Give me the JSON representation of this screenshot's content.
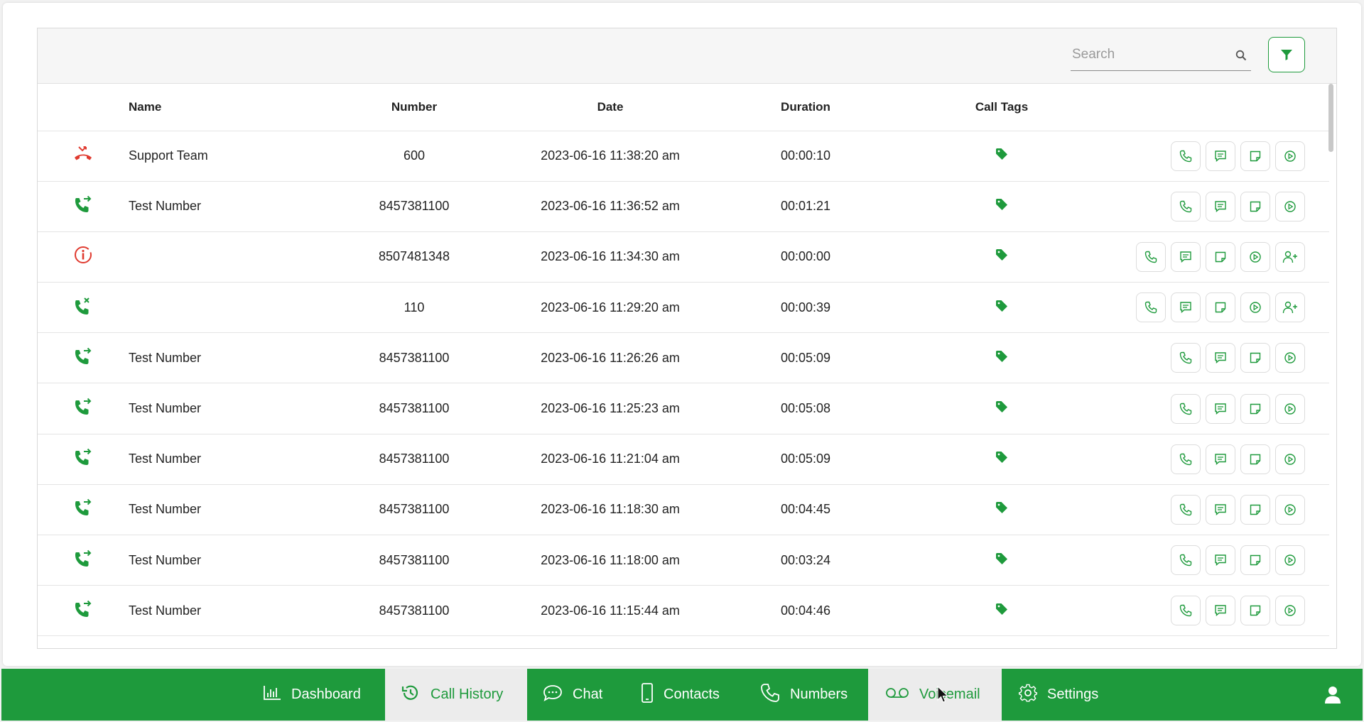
{
  "search": {
    "placeholder": "Search",
    "value": ""
  },
  "columns": {
    "name": "Name",
    "number": "Number",
    "date": "Date",
    "duration": "Duration",
    "call_tags": "Call Tags"
  },
  "colors": {
    "brand_green": "#1e9a3c",
    "missed_red": "#e03a2f"
  },
  "rows": [
    {
      "status_icon": "missed-call-icon",
      "name": "Support Team",
      "number": "600",
      "date": "2023-06-16 11:38:20 am",
      "duration": "00:00:10",
      "has_add_contact": false
    },
    {
      "status_icon": "outgoing-call-icon",
      "name": "Test Number",
      "number": "8457381100",
      "date": "2023-06-16 11:36:52 am",
      "duration": "00:01:21",
      "has_add_contact": false
    },
    {
      "status_icon": "failed-call-icon",
      "name": "",
      "number": "8507481348",
      "date": "2023-06-16 11:34:30 am",
      "duration": "00:00:00",
      "has_add_contact": true
    },
    {
      "status_icon": "rejected-call-icon",
      "name": "",
      "number": "110",
      "date": "2023-06-16 11:29:20 am",
      "duration": "00:00:39",
      "has_add_contact": true
    },
    {
      "status_icon": "outgoing-call-icon",
      "name": "Test Number",
      "number": "8457381100",
      "date": "2023-06-16 11:26:26 am",
      "duration": "00:05:09",
      "has_add_contact": false
    },
    {
      "status_icon": "outgoing-call-icon",
      "name": "Test Number",
      "number": "8457381100",
      "date": "2023-06-16 11:25:23 am",
      "duration": "00:05:08",
      "has_add_contact": false
    },
    {
      "status_icon": "outgoing-call-icon",
      "name": "Test Number",
      "number": "8457381100",
      "date": "2023-06-16 11:21:04 am",
      "duration": "00:05:09",
      "has_add_contact": false
    },
    {
      "status_icon": "outgoing-call-icon",
      "name": "Test Number",
      "number": "8457381100",
      "date": "2023-06-16 11:18:30 am",
      "duration": "00:04:45",
      "has_add_contact": false
    },
    {
      "status_icon": "outgoing-call-icon",
      "name": "Test Number",
      "number": "8457381100",
      "date": "2023-06-16 11:18:00 am",
      "duration": "00:03:24",
      "has_add_contact": false
    },
    {
      "status_icon": "outgoing-call-icon",
      "name": "Test Number",
      "number": "8457381100",
      "date": "2023-06-16 11:15:44 am",
      "duration": "00:04:46",
      "has_add_contact": false
    }
  ],
  "nav": {
    "items": [
      {
        "id": "dashboard",
        "label": "Dashboard",
        "icon": "bar-chart-icon",
        "state": ""
      },
      {
        "id": "call-history",
        "label": "Call History",
        "icon": "history-icon",
        "state": "active"
      },
      {
        "id": "chat",
        "label": "Chat",
        "icon": "chat-bubble-icon",
        "state": ""
      },
      {
        "id": "contacts",
        "label": "Contacts",
        "icon": "mobile-phone-icon",
        "state": ""
      },
      {
        "id": "numbers",
        "label": "Numbers",
        "icon": "phone-icon",
        "state": ""
      },
      {
        "id": "voicemail",
        "label": "Voicemail",
        "icon": "voicemail-icon",
        "state": "hover"
      },
      {
        "id": "settings",
        "label": "Settings",
        "icon": "gear-icon",
        "state": ""
      }
    ],
    "profile_icon": "user-icon"
  }
}
